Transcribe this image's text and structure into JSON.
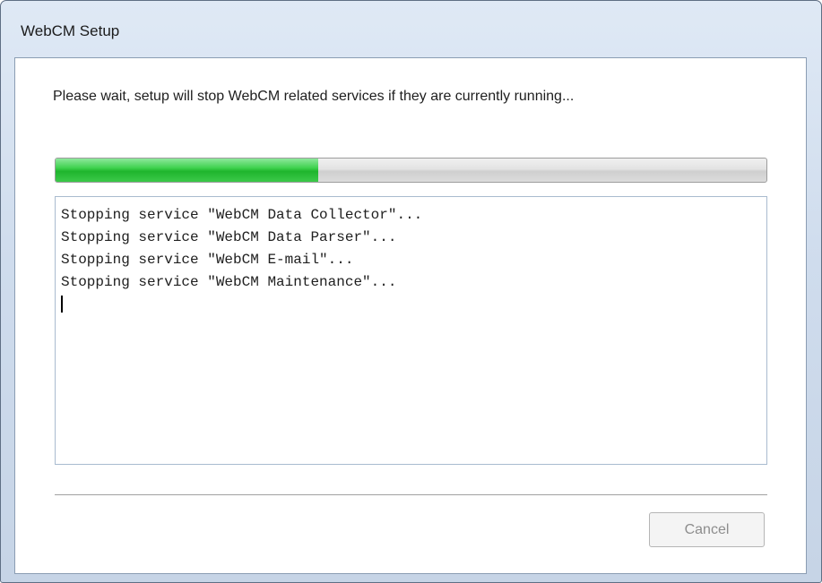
{
  "window": {
    "title": "WebCM Setup"
  },
  "main": {
    "message": "Please wait, setup will stop WebCM related services if they are currently running...",
    "progress": {
      "percent": 37,
      "color": "#2bc43b"
    },
    "log": {
      "lines": [
        "Stopping service \"WebCM Data Collector\"...",
        "Stopping service \"WebCM Data Parser\"...",
        "Stopping service \"WebCM E-mail\"...",
        "Stopping service \"WebCM Maintenance\"..."
      ]
    }
  },
  "buttons": {
    "cancel_label": "Cancel",
    "cancel_enabled": false
  }
}
